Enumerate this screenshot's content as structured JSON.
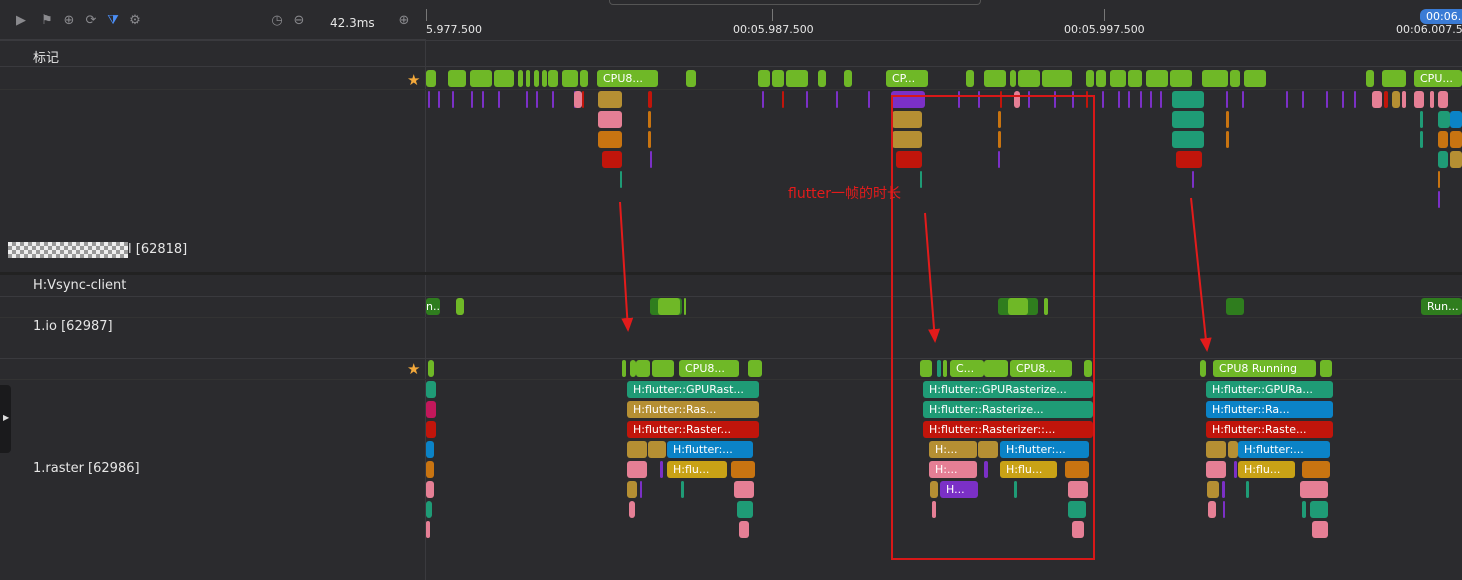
{
  "toolbar": {
    "zoom": "42.3ms",
    "icons": [
      "play-icon",
      "flag-icon",
      "add-circle-icon",
      "sync-icon",
      "filter-icon",
      "gear-icon",
      "stopwatch-icon",
      "zoom-out-icon",
      "zoom-in-icon"
    ]
  },
  "ruler": {
    "ticks": [
      "5.977.500",
      "00:05.987.500",
      "00:05.997.500",
      "00:06.007.5"
    ],
    "cursor_chip": "00:06."
  },
  "rows": {
    "marks_label": "标记",
    "process_label": "l [62818]",
    "vsync_label": "H:Vsync-client",
    "io_label": "1.io [62987]",
    "raster_label": "1.raster [62986]"
  },
  "annotation": {
    "text": "flutter一帧的时长"
  },
  "labels": {
    "cpu8_trunc": "CPU8...",
    "cp_trunc": "CP...",
    "cpu_trunc": "CPU...",
    "c_trunc": "C...",
    "run_trunc": "Run...",
    "cpu8_running": "CPU8 Running",
    "gpu1": "H:flutter::GPURast...",
    "ras1": "H:flutter::Ras...",
    "raster1": "H:flutter::Raster...",
    "hflutter1": "H:flutter:...",
    "hflu1": "H:flu...",
    "gpu2": "H:flutter::GPURasterize...",
    "ras2": "H:flutter::Rasterize...",
    "raster2": "H:flutter::Rasterizer::...",
    "h_trunc": "H:...",
    "h_short": "H...",
    "gpu3": "H:flutter::GPURa...",
    "ras3": "H:flutter::Ra...",
    "raster3": "H:flutter::Raste..."
  },
  "colors": {
    "green": "#6fb827",
    "dark_green": "#2f7d1e",
    "gold": "#b58f33",
    "pink": "#e57f95",
    "orange": "#c87411",
    "red": "#c1150b",
    "teal": "#1f9b76",
    "blue": "#0b83c7",
    "purple": "#7b30c6",
    "annotation_red": "#d81818"
  }
}
